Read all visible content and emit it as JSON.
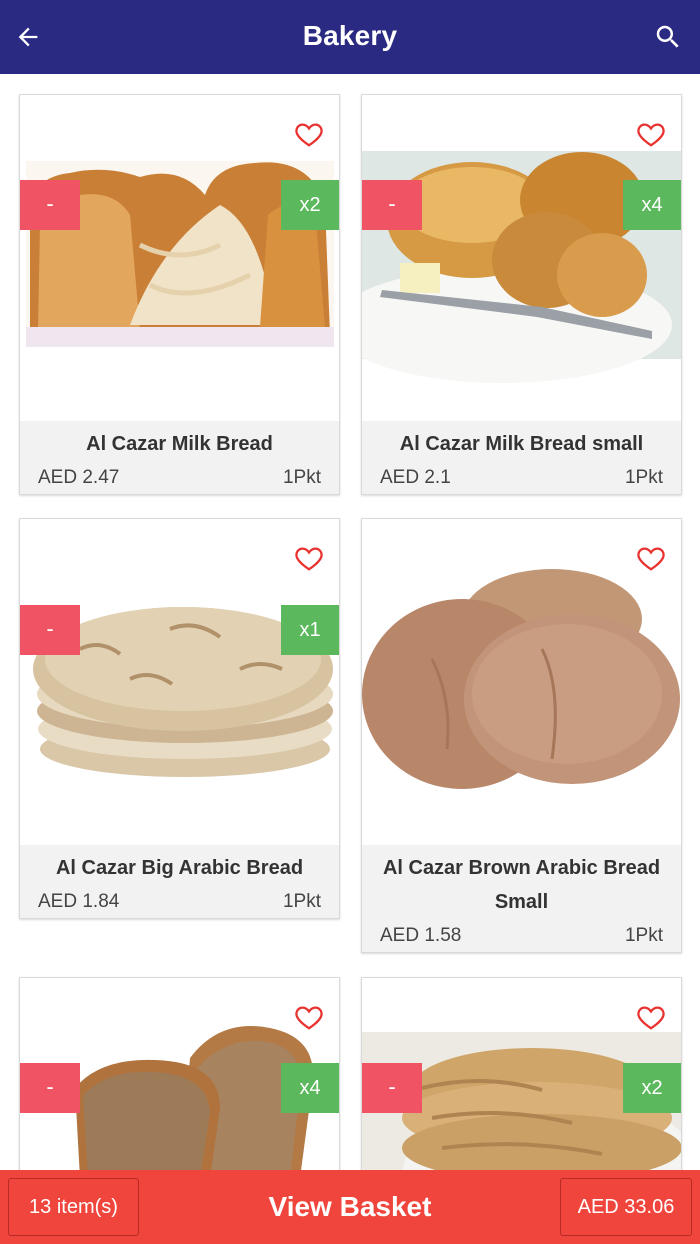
{
  "header": {
    "title": "Bakery",
    "back_icon": "arrow-left-icon",
    "search_icon": "search-icon",
    "background": "#2b2a82"
  },
  "products": [
    {
      "name": "Al Cazar Milk Bread",
      "price": "AED 2.47",
      "unit": "1Pkt",
      "minus_label": "-",
      "qty_label": "x2",
      "image": "milk-bread-loaf-image"
    },
    {
      "name": "Al Cazar Milk Bread small",
      "price": "AED 2.1",
      "unit": "1Pkt",
      "minus_label": "-",
      "qty_label": "x4",
      "image": "bread-rolls-plate-image"
    },
    {
      "name": "Al Cazar Big Arabic Bread",
      "price": "AED 1.84",
      "unit": "1Pkt",
      "minus_label": "-",
      "qty_label": "x1",
      "image": "stacked-pita-bread-image"
    },
    {
      "name": "Al Cazar Brown Arabic Bread Small",
      "price": "AED 1.58",
      "unit": "1Pkt",
      "image": "brown-pita-bread-image"
    },
    {
      "name": "",
      "price": "",
      "unit": "",
      "minus_label": "-",
      "qty_label": "x4",
      "image": "brown-sliced-bread-image"
    },
    {
      "name": "",
      "price": "",
      "unit": "",
      "minus_label": "-",
      "qty_label": "x2",
      "image": "folded-paratha-image"
    }
  ],
  "basket": {
    "items_label": "13 item(s)",
    "view_label": "View Basket",
    "total_label": "AED 33.06",
    "background": "#f0453c"
  },
  "colors": {
    "minus": "#f05363",
    "quantity": "#5cb85c",
    "heart": "#e8322f"
  }
}
